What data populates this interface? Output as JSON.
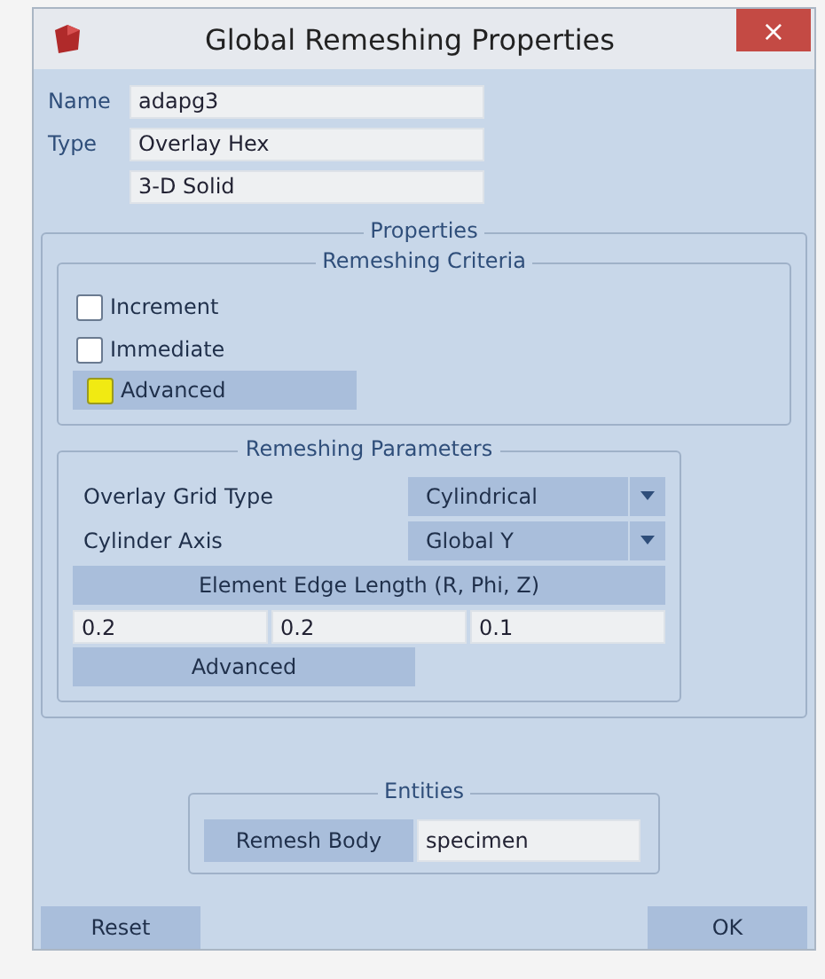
{
  "window": {
    "title": "Global Remeshing Properties",
    "close": "×"
  },
  "fields": [
    {
      "label": "Name",
      "value": "adapg3"
    },
    {
      "label": "Type",
      "value": "Overlay Hex"
    },
    {
      "value": "3-D Solid"
    }
  ],
  "properties": {
    "title": "Properties",
    "criteria": {
      "title": "Remeshing Criteria",
      "items": [
        {
          "kind": "checkbox",
          "label": "Increment",
          "checked": false
        },
        {
          "kind": "checkbox",
          "label": "Immediate",
          "checked": false
        },
        {
          "kind": "toggle-button",
          "label": "Advanced",
          "checked": true
        }
      ]
    },
    "parameters": {
      "title": "Remeshing Parameters",
      "dropdowns": [
        {
          "label": "Overlay Grid Type",
          "value": "Cylindrical"
        },
        {
          "label": "Cylinder Axis",
          "value": "Global Y"
        }
      ],
      "edge_length_button": "Element Edge Length (R, Phi, Z)",
      "edge_lengths": [
        "0.2",
        "0.2",
        "0.1"
      ],
      "advanced_button": "Advanced"
    }
  },
  "entities": {
    "title": "Entities",
    "button": "Remesh Body",
    "value": "specimen"
  },
  "buttons": [
    "Reset",
    "OK"
  ]
}
